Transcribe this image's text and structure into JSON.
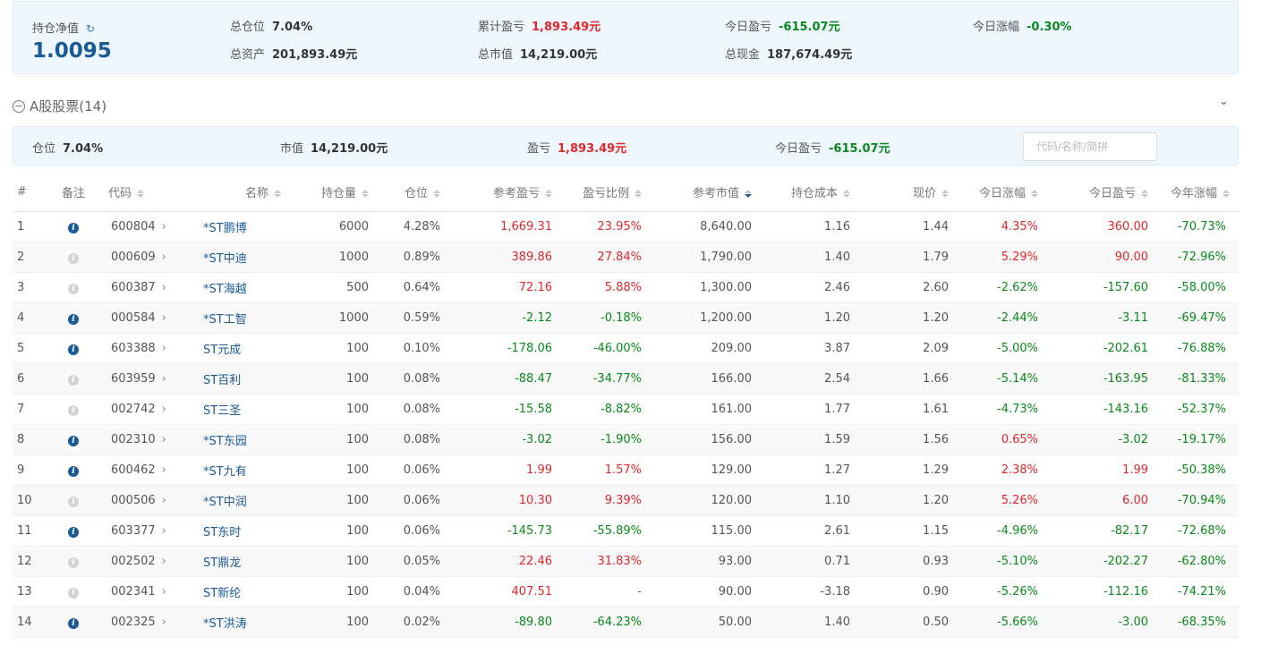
{
  "summary": {
    "nav_label": "持仓净值",
    "nav_value": "1.0095",
    "total_position_label": "总仓位",
    "total_position": "7.04%",
    "total_assets_label": "总资产",
    "total_assets": "201,893.49元",
    "cum_pnl_label": "累计盈亏",
    "cum_pnl": "1,893.49元",
    "total_mv_label": "总市值",
    "total_mv": "14,219.00元",
    "today_pnl_label": "今日盈亏",
    "today_pnl": "-615.07元",
    "total_cash_label": "总现金",
    "total_cash": "187,674.49元",
    "today_change_label": "今日涨幅",
    "today_change": "-0.30%"
  },
  "section": {
    "title": "A股股票(14)",
    "position_label": "仓位",
    "position": "7.04%",
    "mv_label": "市值",
    "mv": "14,219.00元",
    "pnl_label": "盈亏",
    "pnl": "1,893.49元",
    "today_pnl_label": "今日盈亏",
    "today_pnl": "-615.07元",
    "search_placeholder": "代码/名称/简拼"
  },
  "table": {
    "headers": [
      "#",
      "备注",
      "代码",
      "名称",
      "持仓量",
      "仓位",
      "参考盈亏",
      "盈亏比例",
      "参考市值",
      "持仓成本",
      "现价",
      "今日涨幅",
      "今日盈亏",
      "今年涨幅"
    ],
    "rows": [
      {
        "i": "1",
        "note": true,
        "code": "600804",
        "name": "*ST鹏博",
        "qty": "6000",
        "pos": "4.28%",
        "pnl": "1,669.31",
        "ratio": "23.95%",
        "mv": "8,640.00",
        "cost": "1.16",
        "price": "1.44",
        "chg": "4.35%",
        "tpnl": "360.00",
        "ytd": "-70.73%"
      },
      {
        "i": "2",
        "note": false,
        "code": "000609",
        "name": "*ST中迪",
        "qty": "1000",
        "pos": "0.89%",
        "pnl": "389.86",
        "ratio": "27.84%",
        "mv": "1,790.00",
        "cost": "1.40",
        "price": "1.79",
        "chg": "5.29%",
        "tpnl": "90.00",
        "ytd": "-72.96%"
      },
      {
        "i": "3",
        "note": false,
        "code": "600387",
        "name": "*ST海越",
        "qty": "500",
        "pos": "0.64%",
        "pnl": "72.16",
        "ratio": "5.88%",
        "mv": "1,300.00",
        "cost": "2.46",
        "price": "2.60",
        "chg": "-2.62%",
        "tpnl": "-157.60",
        "ytd": "-58.00%"
      },
      {
        "i": "4",
        "note": true,
        "code": "000584",
        "name": "*ST工智",
        "qty": "1000",
        "pos": "0.59%",
        "pnl": "-2.12",
        "ratio": "-0.18%",
        "mv": "1,200.00",
        "cost": "1.20",
        "price": "1.20",
        "chg": "-2.44%",
        "tpnl": "-3.11",
        "ytd": "-69.47%"
      },
      {
        "i": "5",
        "note": true,
        "code": "603388",
        "name": "ST元成",
        "qty": "100",
        "pos": "0.10%",
        "pnl": "-178.06",
        "ratio": "-46.00%",
        "mv": "209.00",
        "cost": "3.87",
        "price": "2.09",
        "chg": "-5.00%",
        "tpnl": "-202.61",
        "ytd": "-76.88%"
      },
      {
        "i": "6",
        "note": false,
        "code": "603959",
        "name": "ST百利",
        "qty": "100",
        "pos": "0.08%",
        "pnl": "-88.47",
        "ratio": "-34.77%",
        "mv": "166.00",
        "cost": "2.54",
        "price": "1.66",
        "chg": "-5.14%",
        "tpnl": "-163.95",
        "ytd": "-81.33%"
      },
      {
        "i": "7",
        "note": false,
        "code": "002742",
        "name": "ST三圣",
        "qty": "100",
        "pos": "0.08%",
        "pnl": "-15.58",
        "ratio": "-8.82%",
        "mv": "161.00",
        "cost": "1.77",
        "price": "1.61",
        "chg": "-4.73%",
        "tpnl": "-143.16",
        "ytd": "-52.37%"
      },
      {
        "i": "8",
        "note": true,
        "code": "002310",
        "name": "*ST东园",
        "qty": "100",
        "pos": "0.08%",
        "pnl": "-3.02",
        "ratio": "-1.90%",
        "mv": "156.00",
        "cost": "1.59",
        "price": "1.56",
        "chg": "0.65%",
        "tpnl": "-3.02",
        "ytd": "-19.17%"
      },
      {
        "i": "9",
        "note": true,
        "code": "600462",
        "name": "*ST九有",
        "qty": "100",
        "pos": "0.06%",
        "pnl": "1.99",
        "ratio": "1.57%",
        "mv": "129.00",
        "cost": "1.27",
        "price": "1.29",
        "chg": "2.38%",
        "tpnl": "1.99",
        "ytd": "-50.38%"
      },
      {
        "i": "10",
        "note": false,
        "code": "000506",
        "name": "*ST中润",
        "qty": "100",
        "pos": "0.06%",
        "pnl": "10.30",
        "ratio": "9.39%",
        "mv": "120.00",
        "cost": "1.10",
        "price": "1.20",
        "chg": "5.26%",
        "tpnl": "6.00",
        "ytd": "-70.94%"
      },
      {
        "i": "11",
        "note": true,
        "code": "603377",
        "name": "ST东时",
        "qty": "100",
        "pos": "0.06%",
        "pnl": "-145.73",
        "ratio": "-55.89%",
        "mv": "115.00",
        "cost": "2.61",
        "price": "1.15",
        "chg": "-4.96%",
        "tpnl": "-82.17",
        "ytd": "-72.68%"
      },
      {
        "i": "12",
        "note": false,
        "code": "002502",
        "name": "ST鼎龙",
        "qty": "100",
        "pos": "0.05%",
        "pnl": "22.46",
        "ratio": "31.83%",
        "mv": "93.00",
        "cost": "0.71",
        "price": "0.93",
        "chg": "-5.10%",
        "tpnl": "-202.27",
        "ytd": "-62.80%"
      },
      {
        "i": "13",
        "note": false,
        "code": "002341",
        "name": "ST新纶",
        "qty": "100",
        "pos": "0.04%",
        "pnl": "407.51",
        "ratio": "-",
        "mv": "90.00",
        "cost": "-3.18",
        "price": "0.90",
        "chg": "-5.26%",
        "tpnl": "-112.16",
        "ytd": "-74.21%"
      },
      {
        "i": "14",
        "note": true,
        "code": "002325",
        "name": "*ST洪涛",
        "qty": "100",
        "pos": "0.02%",
        "pnl": "-89.80",
        "ratio": "-64.23%",
        "mv": "50.00",
        "cost": "1.40",
        "price": "0.50",
        "chg": "-5.66%",
        "tpnl": "-3.00",
        "ytd": "-68.35%"
      }
    ]
  }
}
